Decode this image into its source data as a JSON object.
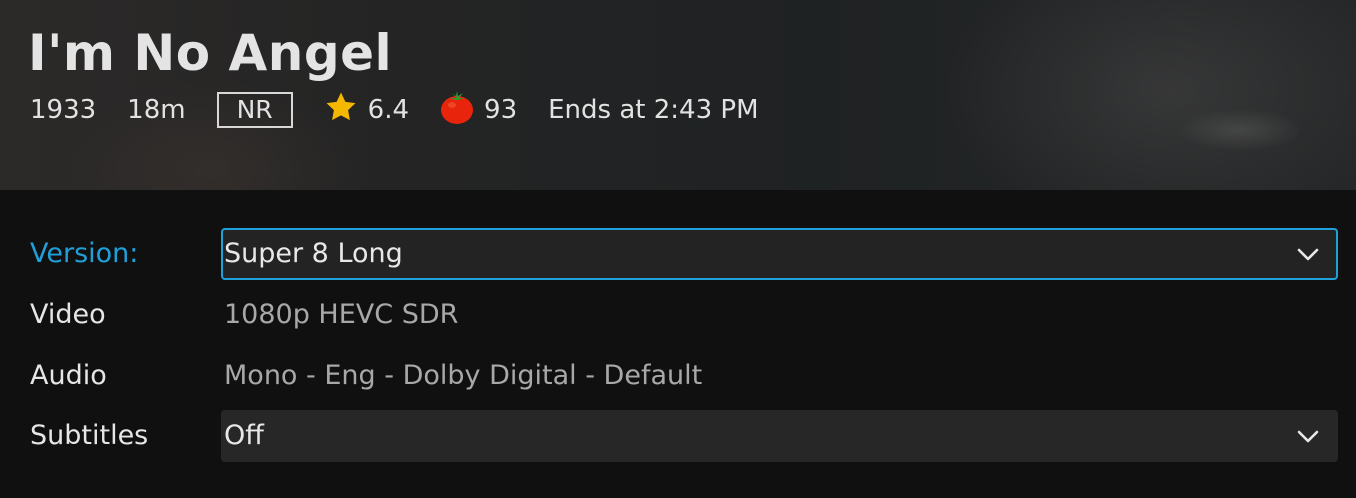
{
  "header": {
    "title": "I'm No Angel",
    "year": "1933",
    "runtime": "18m",
    "official_rating": "NR",
    "community_rating": "6.4",
    "critic_rating": "93",
    "ends_at": "Ends at 2:43 PM",
    "icons": {
      "star": "star-icon",
      "tomato": "tomato-icon"
    }
  },
  "form": {
    "version": {
      "label": "Version:",
      "value": "Super 8 Long"
    },
    "video": {
      "label": "Video",
      "value": "1080p HEVC SDR"
    },
    "audio": {
      "label": "Audio",
      "value": "Mono - Eng - Dolby Digital - Default"
    },
    "subtitles": {
      "label": "Subtitles",
      "value": "Off"
    }
  },
  "colors": {
    "accent": "#1fa0d8",
    "star": "#f5b800",
    "tomato": "#e8240c",
    "background": "#101010"
  }
}
